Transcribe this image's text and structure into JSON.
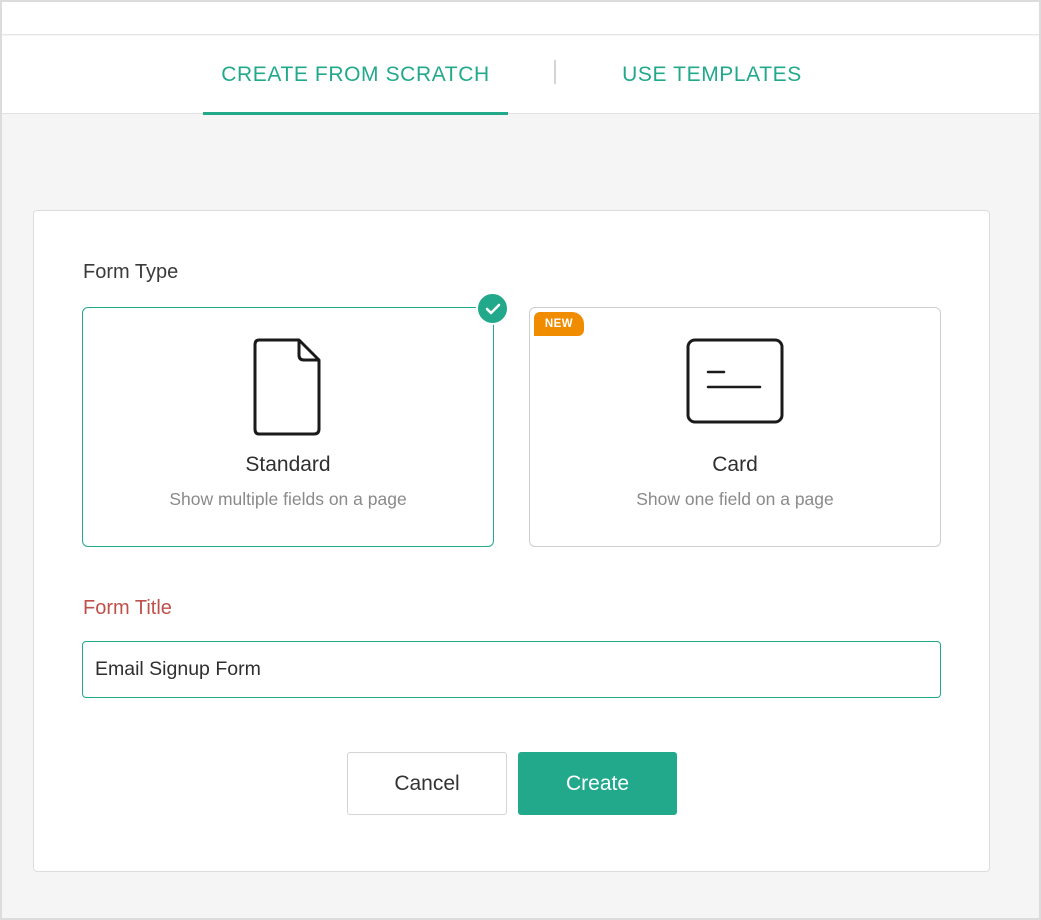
{
  "tabs": {
    "scratch_label": "CREATE FROM SCRATCH",
    "templates_label": "USE TEMPLATES"
  },
  "form_type": {
    "label": "Form Type",
    "options": [
      {
        "title": "Standard",
        "description": "Show multiple fields on a page",
        "icon": "document-icon",
        "selected": true
      },
      {
        "title": "Card",
        "description": "Show one field on a page",
        "icon": "card-icon",
        "badge": "NEW",
        "selected": false
      }
    ]
  },
  "form_title": {
    "label": "Form Title",
    "value": "Email Signup Form"
  },
  "buttons": {
    "cancel": "Cancel",
    "create": "Create"
  },
  "colors": {
    "accent": "#22a98b",
    "error_label": "#c0504b",
    "badge": "#f08c00"
  }
}
